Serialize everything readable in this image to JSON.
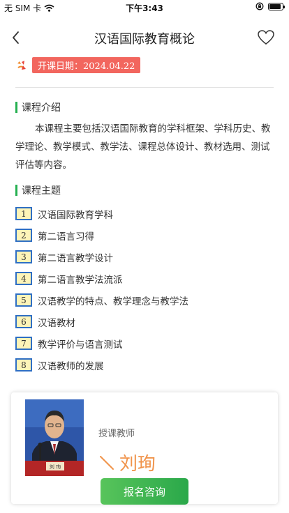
{
  "status_bar": {
    "carrier": "无 SIM 卡",
    "time": "下午3:43",
    "battery_level": 0.9
  },
  "nav": {
    "title": "汉语国际教育概论",
    "back_icon": "chevron-left-icon",
    "favorite_icon": "heart-outline-icon"
  },
  "course": {
    "date_label": "开课日期：",
    "date_value": "2024.04.22"
  },
  "intro": {
    "heading": "课程介绍",
    "text": "本课程主要包括汉语国际教育的学科框架、学科历史、教学理论、教学模式、教学法、课程总体设计、教材选用、测试评估等内容。"
  },
  "topics": {
    "heading": "课程主题",
    "items": [
      {
        "num": "1",
        "label": "汉语国际教育学科"
      },
      {
        "num": "2",
        "label": "第二语言习得"
      },
      {
        "num": "3",
        "label": "第二语言教学设计"
      },
      {
        "num": "4",
        "label": "第二语言教学法流派"
      },
      {
        "num": "5",
        "label": "汉语教学的特点、教学理念与教学法"
      },
      {
        "num": "6",
        "label": "汉语教材"
      },
      {
        "num": "7",
        "label": "教学评价与语言测试"
      },
      {
        "num": "8",
        "label": "汉语教师的发展"
      }
    ]
  },
  "teacher": {
    "role": "授课教师",
    "name": "刘珣",
    "nameplate": "刘 珣"
  },
  "actions": {
    "consult_label": "报名咨询"
  },
  "colors": {
    "accent_green": "#25b050",
    "date_badge_red": "#f2665e",
    "topic_num_border": "#2f6fc4",
    "topic_num_bg": "#fdf4b8",
    "teacher_name": "#f0934a"
  }
}
